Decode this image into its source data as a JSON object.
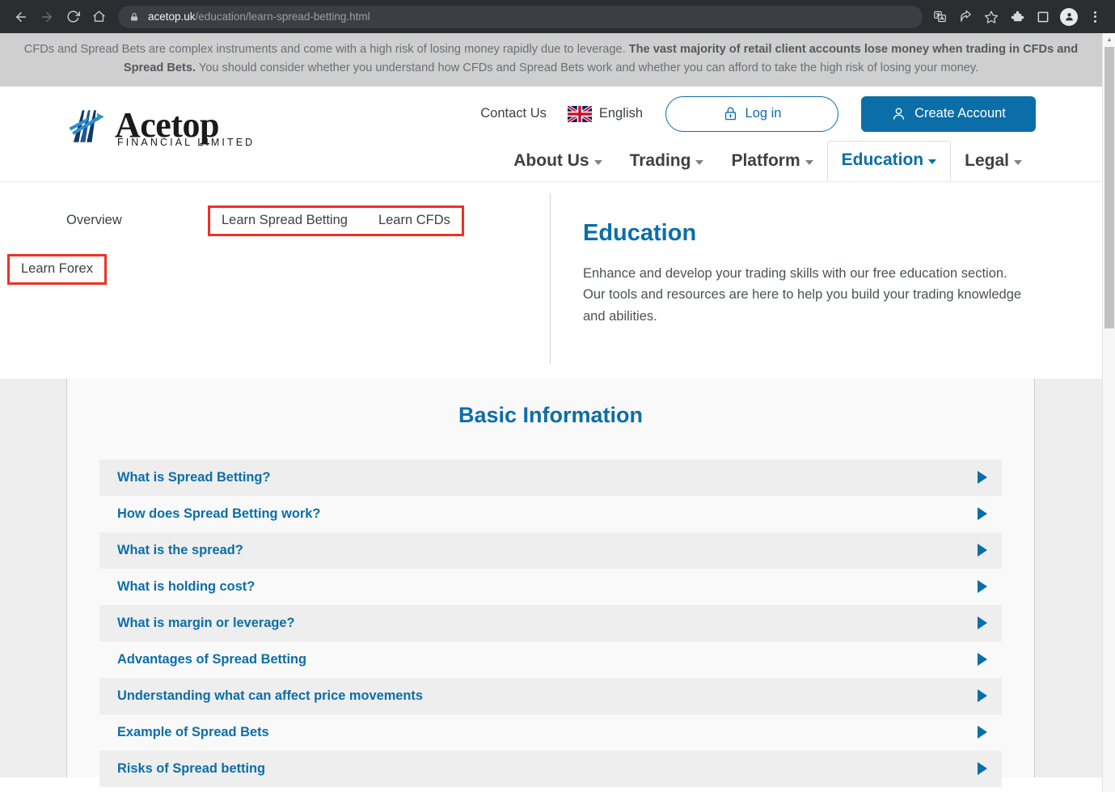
{
  "browser": {
    "back_icon": "back-arrow-icon",
    "forward_icon": "forward-arrow-icon",
    "reload_icon": "reload-icon",
    "home_icon": "home-icon",
    "lock_icon": "lock-icon",
    "url_host": "acetop.uk",
    "url_path": "/education/learn-spread-betting.html",
    "toolbar_icons": [
      "translate-icon",
      "share-icon",
      "bookmark-star-icon",
      "extensions-puzzle-icon",
      "side-panel-icon",
      "profile-avatar-icon",
      "more-menu-icon"
    ]
  },
  "scrollbar": {
    "up_arrow": "▲",
    "down_arrow": "▼"
  },
  "risk_warning": {
    "part1": "CFDs and Spread Bets are complex instruments and come with a high risk of losing money rapidly due to leverage. ",
    "bold": "The vast majority of retail client accounts lose money when trading in CFDs and Spread Bets.",
    "part2": " You should consider whether you understand how CFDs and Spread Bets work and whether you can afford to take the high risk of losing your money."
  },
  "header": {
    "logo_name": "Acetop",
    "logo_sub": "FINANCIAL LIMITED",
    "contact_us": "Contact Us",
    "language": "English",
    "flag_icon": "uk-flag-icon",
    "login_label": "Log in",
    "login_icon": "lock-icon",
    "create_account_label": "Create Account",
    "create_account_icon": "user-icon",
    "nav": [
      {
        "label": "About Us",
        "active": false
      },
      {
        "label": "Trading",
        "active": false
      },
      {
        "label": "Platform",
        "active": false
      },
      {
        "label": "Education",
        "active": true
      },
      {
        "label": "Legal",
        "active": false
      }
    ]
  },
  "mega_menu": {
    "overview": "Overview",
    "highlighted_group_1": [
      "Learn Spread Betting",
      "Learn CFDs"
    ],
    "highlighted_group_2": [
      "Learn Forex"
    ],
    "highlight_color": "#ef3124",
    "panel": {
      "title": "Education",
      "description": "Enhance and develop your trading skills with our free education section. Our tools and resources are here to help you build your trading knowledge and abilities."
    }
  },
  "content": {
    "section_title": "Basic Information",
    "accordion_items": [
      "What is Spread Betting?",
      "How does Spread Betting work?",
      "What is the spread?",
      "What is holding cost?",
      "What is margin or leverage?",
      "Advantages of Spread Betting",
      "Understanding what can affect price movements",
      "Example of Spread Bets",
      "Risks of Spread betting"
    ],
    "accordion_arrow_icon": "triangle-right-icon",
    "accent_color": "#0b6ea8"
  }
}
